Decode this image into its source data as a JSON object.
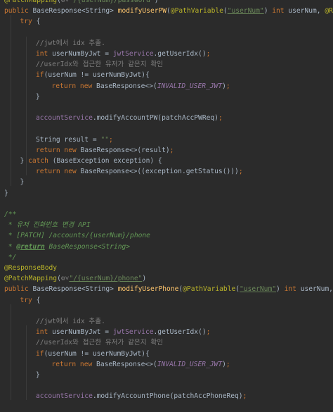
{
  "editor": {
    "lines": [
      {
        "indent": 0,
        "tokens": [
          [
            "ann",
            "@PatchMapping"
          ],
          [
            "pl",
            "("
          ],
          [
            "gear",
            "⚙˅"
          ],
          [
            "str",
            "\"/{userNum}/password\""
          ],
          [
            "pl",
            ")"
          ]
        ]
      },
      {
        "indent": 0,
        "tokens": [
          [
            "kw",
            "public "
          ],
          [
            "pl",
            "BaseResponse<String> "
          ],
          [
            "fn",
            "modifyUserPW"
          ],
          [
            "pl",
            "("
          ],
          [
            "ann",
            "@PathVariable"
          ],
          [
            "pl",
            "("
          ],
          [
            "strU",
            "\"userNum\""
          ],
          [
            "pl",
            ") "
          ],
          [
            "kw",
            "int "
          ],
          [
            "pl",
            "userNum, "
          ],
          [
            "ann",
            "@Reque"
          ]
        ]
      },
      {
        "indent": 1,
        "tokens": [
          [
            "kw",
            "try "
          ],
          [
            "pl",
            "{"
          ]
        ]
      },
      {
        "indent": 0,
        "tokens": []
      },
      {
        "indent": 2,
        "tokens": [
          [
            "cmt",
            "//"
          ],
          [
            "cmt",
            "jwt"
          ],
          [
            "cmt",
            "에서 idx 추출."
          ]
        ]
      },
      {
        "indent": 2,
        "tokens": [
          [
            "kw",
            "int "
          ],
          [
            "pl",
            "userNumByJwt = "
          ],
          [
            "fld",
            "jwtService"
          ],
          [
            "pl",
            ".getUserIdx()"
          ],
          [
            "kw",
            ";"
          ]
        ]
      },
      {
        "indent": 2,
        "tokens": [
          [
            "cmt",
            "//user"
          ],
          [
            "cmt",
            "Idx"
          ],
          [
            "cmt",
            "와 접근한 유저가 같은지 확인"
          ]
        ]
      },
      {
        "indent": 2,
        "tokens": [
          [
            "kw",
            "if"
          ],
          [
            "pl",
            "(userNum != userNumByJwt){"
          ]
        ]
      },
      {
        "indent": 3,
        "tokens": [
          [
            "kw",
            "return new "
          ],
          [
            "pl",
            "BaseResponse<>("
          ],
          [
            "it",
            "INVALID_USER_JWT"
          ],
          [
            "pl",
            ")"
          ],
          [
            "kw",
            ";"
          ]
        ]
      },
      {
        "indent": 2,
        "tokens": [
          [
            "pl",
            "}"
          ]
        ]
      },
      {
        "indent": 0,
        "tokens": []
      },
      {
        "indent": 2,
        "tokens": [
          [
            "fld",
            "accountService"
          ],
          [
            "pl",
            ".modifyAccountPW(patchAccPWReq)"
          ],
          [
            "kw",
            ";"
          ]
        ]
      },
      {
        "indent": 0,
        "tokens": []
      },
      {
        "indent": 2,
        "tokens": [
          [
            "pl",
            "String result = "
          ],
          [
            "str",
            "\"\""
          ],
          [
            "kw",
            ";"
          ]
        ]
      },
      {
        "indent": 2,
        "tokens": [
          [
            "kw",
            "return new "
          ],
          [
            "pl",
            "BaseResponse<>(result)"
          ],
          [
            "kw",
            ";"
          ]
        ]
      },
      {
        "indent": 1,
        "tokens": [
          [
            "pl",
            "} "
          ],
          [
            "kw",
            "catch "
          ],
          [
            "pl",
            "(BaseException exception) {"
          ]
        ]
      },
      {
        "indent": 2,
        "tokens": [
          [
            "kw",
            "return new "
          ],
          [
            "pl",
            "BaseResponse<>((exception.getStatus()))"
          ],
          [
            "kw",
            ";"
          ]
        ]
      },
      {
        "indent": 1,
        "tokens": [
          [
            "pl",
            "}"
          ]
        ]
      },
      {
        "indent": 0,
        "tokens": [
          [
            "pl",
            "}"
          ]
        ]
      },
      {
        "indent": 0,
        "tokens": []
      },
      {
        "indent": 0,
        "tokens": [
          [
            "doc",
            "/**"
          ]
        ]
      },
      {
        "indent": 0,
        "tokens": [
          [
            "doc",
            " * 유저 전화번호 변경 API"
          ]
        ]
      },
      {
        "indent": 0,
        "tokens": [
          [
            "doc",
            " * [PATCH] /accounts/{userNum}/phone"
          ]
        ]
      },
      {
        "indent": 0,
        "tokens": [
          [
            "doc",
            " * "
          ],
          [
            "doctag",
            "@return"
          ],
          [
            "doc",
            " BaseResponse<String>"
          ]
        ]
      },
      {
        "indent": 0,
        "tokens": [
          [
            "doc",
            " */"
          ]
        ]
      },
      {
        "indent": 0,
        "tokens": [
          [
            "ann",
            "@ResponseBody"
          ]
        ]
      },
      {
        "indent": 0,
        "tokens": [
          [
            "ann",
            "@PatchMapping"
          ],
          [
            "pl",
            "("
          ],
          [
            "gear",
            "⚙˅"
          ],
          [
            "strU",
            "\"/{userNum}/phone\""
          ],
          [
            "pl",
            ")"
          ]
        ]
      },
      {
        "indent": 0,
        "tokens": [
          [
            "kw",
            "public "
          ],
          [
            "pl",
            "BaseResponse<String> "
          ],
          [
            "fn",
            "modifyUserPhone"
          ],
          [
            "pl",
            "("
          ],
          [
            "ann",
            "@PathVariable"
          ],
          [
            "pl",
            "("
          ],
          [
            "strU",
            "\"userNum\""
          ],
          [
            "pl",
            ") "
          ],
          [
            "kw",
            "int "
          ],
          [
            "pl",
            "userNum, "
          ],
          [
            "ann",
            "@Re"
          ]
        ]
      },
      {
        "indent": 1,
        "tokens": [
          [
            "kw",
            "try "
          ],
          [
            "pl",
            "{"
          ]
        ]
      },
      {
        "indent": 0,
        "tokens": []
      },
      {
        "indent": 2,
        "tokens": [
          [
            "cmt",
            "//"
          ],
          [
            "cmt",
            "jwt"
          ],
          [
            "cmt",
            "에서 idx 추출."
          ]
        ]
      },
      {
        "indent": 2,
        "tokens": [
          [
            "kw",
            "int "
          ],
          [
            "pl",
            "userNumByJwt = "
          ],
          [
            "fld",
            "jwtService"
          ],
          [
            "pl",
            ".getUserIdx()"
          ],
          [
            "kw",
            ";"
          ]
        ]
      },
      {
        "indent": 2,
        "tokens": [
          [
            "cmt",
            "//user"
          ],
          [
            "cmt",
            "Idx"
          ],
          [
            "cmt",
            "와 접근한 유저가 같은지 확인"
          ]
        ]
      },
      {
        "indent": 2,
        "tokens": [
          [
            "kw",
            "if"
          ],
          [
            "pl",
            "(userNum != userNumByJwt){"
          ]
        ]
      },
      {
        "indent": 3,
        "tokens": [
          [
            "kw",
            "return new "
          ],
          [
            "pl",
            "BaseResponse<>("
          ],
          [
            "it",
            "INVALID_USER_JWT"
          ],
          [
            "pl",
            ")"
          ],
          [
            "kw",
            ";"
          ]
        ]
      },
      {
        "indent": 2,
        "tokens": [
          [
            "pl",
            "}"
          ]
        ]
      },
      {
        "indent": 0,
        "tokens": []
      },
      {
        "indent": 2,
        "tokens": [
          [
            "fld",
            "accountService"
          ],
          [
            "pl",
            ".modifyAccountPhone(patchAccPhoneReq)"
          ],
          [
            "kw",
            ";"
          ]
        ]
      }
    ]
  }
}
